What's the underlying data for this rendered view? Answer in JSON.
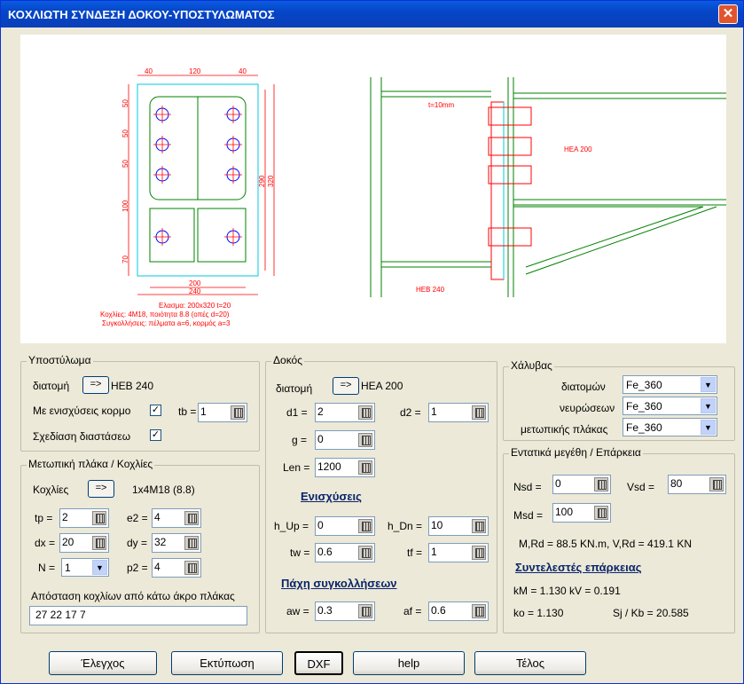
{
  "window": {
    "title": "ΚΟΧΛΙΩΤΗ ΣΥΝΔΕΣΗ ΔΟΚΟΥ-ΥΠΟΣΤΥΛΩΜΑΤΟΣ",
    "close_label": "✕"
  },
  "drawing": {
    "dims_top": [
      "40",
      "120",
      "40"
    ],
    "dims_left": [
      "50",
      "50",
      "50",
      "100",
      "70"
    ],
    "dims_right": [
      "290",
      "320"
    ],
    "dims_bottom": [
      "200",
      "240"
    ],
    "notes": [
      "Ελασμα: 200x320  t=20",
      "Κοχλίες: 4M18, ποιότητα 8.8 (οπές d=20)",
      "Συγκολλήσεις: πέλματα a=6, κορμός a=3"
    ],
    "t_label": "t=10mm",
    "beam_label": "HEA 200",
    "column_label": "HEB 240"
  },
  "column": {
    "legend": "Υποστύλωμα",
    "section_label": "διατομή",
    "section_btn": "=>",
    "section_value": "HEB 240",
    "web_reinf_label": "Με ενισχύσεις κορμο",
    "web_reinf_mark": "✓",
    "tb_label": "tb =",
    "tb_value": "1",
    "draw_dims_label": "Σχεδίαση διαστάσεω",
    "draw_dims_mark": "✓"
  },
  "plate": {
    "legend": "Μετωπική πλάκα / Κοχλίες",
    "bolts_label": "Κοχλίες",
    "bolts_btn": "=>",
    "bolts_value": "1x4M18 (8.8)",
    "tp_label": "tp =",
    "tp_value": "2",
    "e2_label": "e2 =",
    "e2_value": "4",
    "dx_label": "dx =",
    "dx_value": "20",
    "dy_label": "dy =",
    "dy_value": "32",
    "n_label": "N =",
    "n_value": "1",
    "p2_label": "p2 =",
    "p2_value": "4",
    "dist_label": "Απόσταση κοχλίων από κάτω άκρο πλάκας",
    "dist_value": "27 22 17 7"
  },
  "beam": {
    "legend": "Δοκός",
    "section_label": "διατομή",
    "section_btn": "=>",
    "section_value": "HEA 200",
    "d1_label": "d1 =",
    "d1_value": "2",
    "d2_label": "d2 =",
    "d2_value": "1",
    "g_label": "g =",
    "g_value": "0",
    "len_label": "Len =",
    "len_value": "1200",
    "reinf_title": "Ενισχύσεις",
    "hup_label": "h_Up =",
    "hup_value": "0",
    "hdn_label": "h_Dn =",
    "hdn_value": "10",
    "tw_label": "tw =",
    "tw_value": "0.6",
    "tf_label": "tf =",
    "tf_value": "1",
    "weld_title": "Πάχη συγκολλήσεων",
    "aw_label": "aw =",
    "aw_value": "0.3",
    "af_label": "af =",
    "af_value": "0.6"
  },
  "steel": {
    "legend": "Χάλυβας",
    "sections_label": "διατομών",
    "sections_value": "Fe_360",
    "stiff_label": "νευρώσεων",
    "stiff_value": "Fe_360",
    "plate_label": "μετωπικής πλάκας",
    "plate_value": "Fe_360"
  },
  "forces": {
    "legend": "Εντατικά μεγέθη / Επάρκεια",
    "nsd_label": "Nsd =",
    "nsd_value": "0",
    "vsd_label": "Vsd =",
    "vsd_value": "80",
    "msd_label": "Msd =",
    "msd_value": "100",
    "resist": "M,Rd = 88.5 KN.m,  V,Rd = 419.1 KN",
    "coef_title": "Συντελεστές επάρκειας",
    "km_kv": "kM = 1.130  kV = 0.191",
    "ko": "ko = 1.130",
    "sj": "Sj / Kb = 20.585"
  },
  "buttons": {
    "check": "Έλεγχος",
    "print": "Εκτύπωση",
    "dxf": "DXF",
    "help": "help",
    "end": "Τέλος"
  }
}
